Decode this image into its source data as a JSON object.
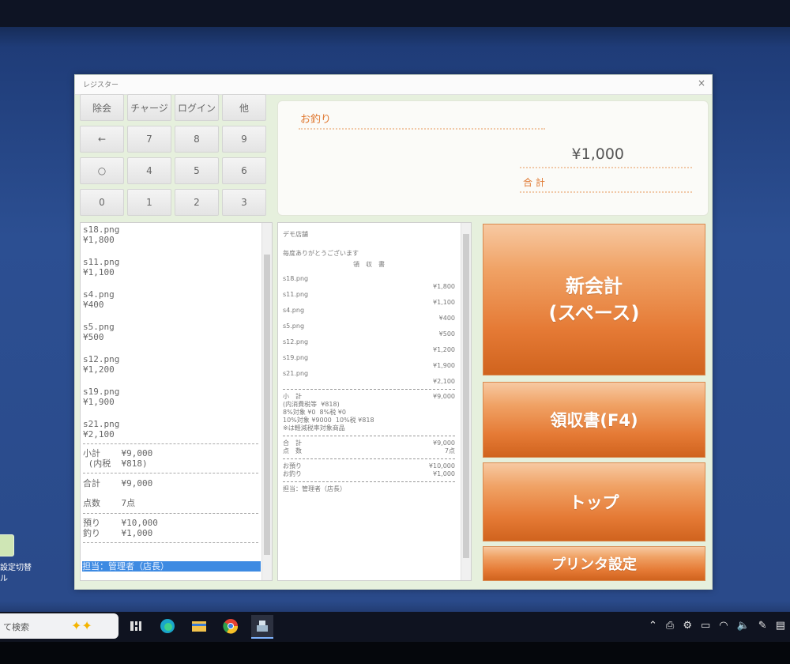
{
  "window": {
    "title": "レジスター",
    "close": "×"
  },
  "keypad": [
    [
      "除会",
      "チャージ",
      "ログイン",
      "他"
    ],
    [
      "←",
      "7",
      "8",
      "9"
    ],
    [
      "○",
      "4",
      "5",
      "6"
    ],
    [
      "0",
      "1",
      "2",
      "3"
    ]
  ],
  "amount": {
    "change_label": "お釣り",
    "value": "¥1,000",
    "total_label": "合計"
  },
  "item_list": {
    "items": [
      {
        "name": "s18.png",
        "price": "¥1,800"
      },
      {
        "name": "s11.png",
        "price": "¥1,100"
      },
      {
        "name": "s4.png",
        "price": "¥400"
      },
      {
        "name": "s5.png",
        "price": "¥500"
      },
      {
        "name": "s12.png",
        "price": "¥1,200"
      },
      {
        "name": "s19.png",
        "price": "¥1,900"
      },
      {
        "name": "s21.png",
        "price": "¥2,100"
      }
    ],
    "subtotal": "小計    ¥9,000",
    "tax": " (内税  ¥818)",
    "total": "合計    ¥9,000",
    "count": "点数    7点",
    "received": "預り    ¥10,000",
    "change": "釣り    ¥1,000",
    "staff": "担当：管理者（店長）"
  },
  "receipt": {
    "store": "デモ店舗",
    "thanks": "毎度ありがとうございます",
    "heading": "領　収　書",
    "items": [
      {
        "name": "s18.png",
        "price": "¥1,800"
      },
      {
        "name": "s11.png",
        "price": "¥1,100"
      },
      {
        "name": "s4.png",
        "price": "¥400"
      },
      {
        "name": "s5.png",
        "price": "¥500"
      },
      {
        "name": "s12.png",
        "price": "¥1,200"
      },
      {
        "name": "s19.png",
        "price": "¥1,900"
      },
      {
        "name": "s21.png",
        "price": "¥2,100"
      }
    ],
    "subtotal_label": "小　計",
    "subtotal": "¥9,000",
    "tax_lines": [
      "(内消費税等  ¥818)",
      "8%対象 ¥0  8%税 ¥0",
      "10%対象 ¥9000  10%税 ¥818",
      "※は軽減税率対象商品"
    ],
    "total_label": "合　計",
    "total": "¥9,000",
    "count_label": "点　数",
    "count": "7点",
    "received_label": "お預り",
    "received": "¥10,000",
    "change_label": "お釣り",
    "change": "¥1,000",
    "staff": "担当：管理者（店長）"
  },
  "buttons": {
    "new": "新会計\n(スペース)",
    "receipt": "領収書(F4)",
    "top": "トップ",
    "printer": "プリンタ設定"
  },
  "desktop": {
    "icon_label": "設定切替\nル"
  },
  "taskbar": {
    "search": "て検索",
    "sparkle": "✦✦"
  },
  "colors": {
    "accent": "#e57a35",
    "label": "#e07a33",
    "window_bg": "#e6f0dd",
    "highlight": "#3d8ae2"
  }
}
